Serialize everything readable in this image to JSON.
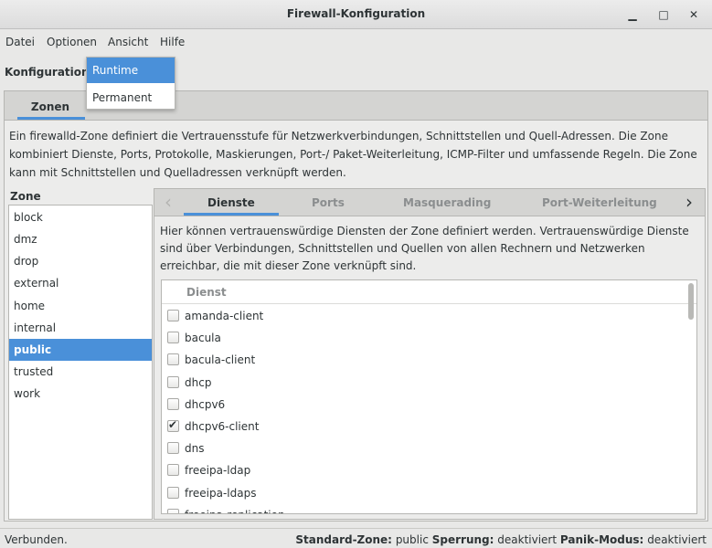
{
  "window": {
    "title": "Firewall-Konfiguration",
    "minimize": "▁",
    "maximize": "□",
    "close": "✕"
  },
  "menu": [
    "Datei",
    "Optionen",
    "Ansicht",
    "Hilfe"
  ],
  "konfiguration": {
    "label": "Konfiguration:",
    "options": [
      "Runtime",
      "Permanent"
    ],
    "selected": "Runtime"
  },
  "main_tab": "Zonen",
  "zone_description": "Ein firewalld-Zone definiert die Vertrauensstufe für Netzwerkverbindungen, Schnittstellen und Quell-Adressen. Die Zone kombiniert Dienste, Ports, Protokolle, Maskierungen, Port-/ Paket-Weiterleitung, ICMP-Filter und umfassende Regeln. Die Zone kann mit Schnittstellen und Quelladressen verknüpft werden.",
  "zones": {
    "header": "Zone",
    "items": [
      "block",
      "dmz",
      "drop",
      "external",
      "home",
      "internal",
      "public",
      "trusted",
      "work"
    ],
    "selected": "public"
  },
  "subtabs": {
    "items": [
      "Dienste",
      "Ports",
      "Masquerading",
      "Port-Weiterleitung"
    ],
    "active": "Dienste",
    "prev_icon": "chevron-left-icon",
    "next_icon": "chevron-right-icon"
  },
  "services_description": "Hier können  vertrauenswürdige Diensten der Zone definiert werden. Vertrauenswürdige Dienste sind über Verbindungen, Schnittstellen und Quellen von allen Rechnern und Netzwerken erreichbar, die mit dieser Zone verknüpft sind.",
  "services": {
    "header": "Dienst",
    "rows": [
      {
        "name": "amanda-client",
        "checked": false
      },
      {
        "name": "bacula",
        "checked": false
      },
      {
        "name": "bacula-client",
        "checked": false
      },
      {
        "name": "dhcp",
        "checked": false
      },
      {
        "name": "dhcpv6",
        "checked": false
      },
      {
        "name": "dhcpv6-client",
        "checked": true
      },
      {
        "name": "dns",
        "checked": false
      },
      {
        "name": "freeipa-ldap",
        "checked": false
      },
      {
        "name": "freeipa-ldaps",
        "checked": false
      },
      {
        "name": "freeipa-replication",
        "checked": false
      }
    ]
  },
  "status": {
    "connection": "Verbunden.",
    "standard_zone_label": "Standard-Zone:",
    "standard_zone_value": "public",
    "sperrung_label": "Sperrung:",
    "sperrung_value": "deaktiviert",
    "panik_label": "Panik-Modus:",
    "panik_value": "deaktiviert"
  },
  "colors": {
    "accent": "#4a90d9",
    "text": "#2e3436",
    "inactive_text": "#8b8e8f"
  }
}
